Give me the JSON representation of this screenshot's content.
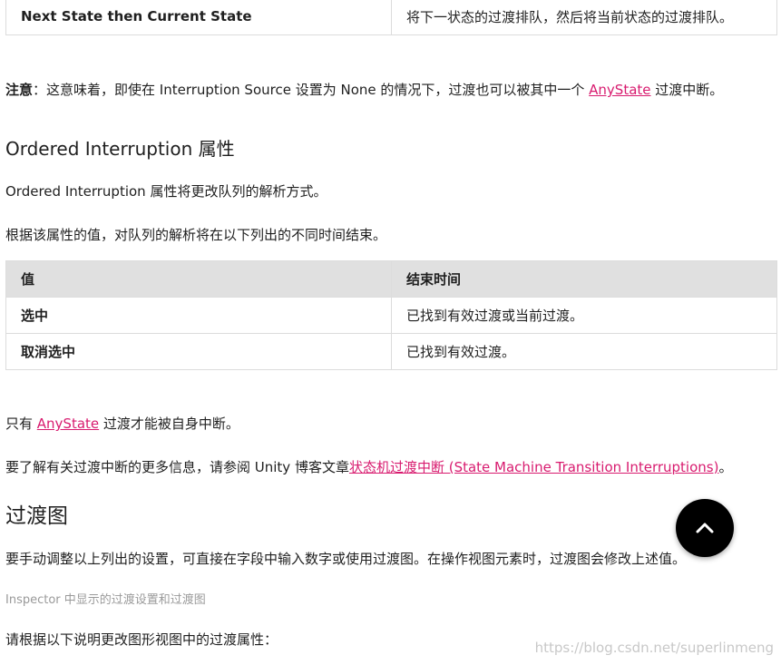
{
  "top_table": {
    "rows": [
      {
        "key": "Next State then Current State",
        "value": "将下一状态的过渡排队，然后将当前状态的过渡排队。"
      }
    ]
  },
  "note": {
    "label": "注意",
    "text_before": "：这意味着，即使在 Interruption Source 设置为 None 的情况下，过渡也可以被其中一个 ",
    "link": "AnyState",
    "text_after": " 过渡中断。"
  },
  "section1": {
    "heading": "Ordered Interruption 属性",
    "para1": "Ordered Interruption 属性将更改队列的解析方式。",
    "para2": "根据该属性的值，对队列的解析将在以下列出的不同时间结束。"
  },
  "table2": {
    "headers": [
      "值",
      "结束时间"
    ],
    "rows": [
      {
        "key": "选中",
        "value": "已找到有效过渡或当前过渡。"
      },
      {
        "key": "取消选中",
        "value": "已找到有效过渡。"
      }
    ]
  },
  "para_anystate": {
    "before": "只有 ",
    "link": "AnyState",
    "after": " 过渡才能被自身中断。"
  },
  "para_more": {
    "before": "要了解有关过渡中断的更多信息，请参阅 Unity 博客文章",
    "link": "状态机过渡中断 (State Machine Transition Interruptions)",
    "after": "。"
  },
  "section2": {
    "heading": "过渡图",
    "para": "要手动调整以上列出的设置，可直接在字段中输入数字或使用过渡图。在操作视图元素时，过渡图会修改上述值。",
    "caption": "Inspector 中显示的过渡设置和过渡图",
    "para_last": "请根据以下说明更改图形视图中的过渡属性："
  },
  "icons": {
    "scroll_top": "chevron-up-icon"
  },
  "watermark": "https://blog.csdn.net/superlinmeng",
  "colors": {
    "link": "#d81b6f",
    "table_header_bg": "#e0e0e0"
  }
}
